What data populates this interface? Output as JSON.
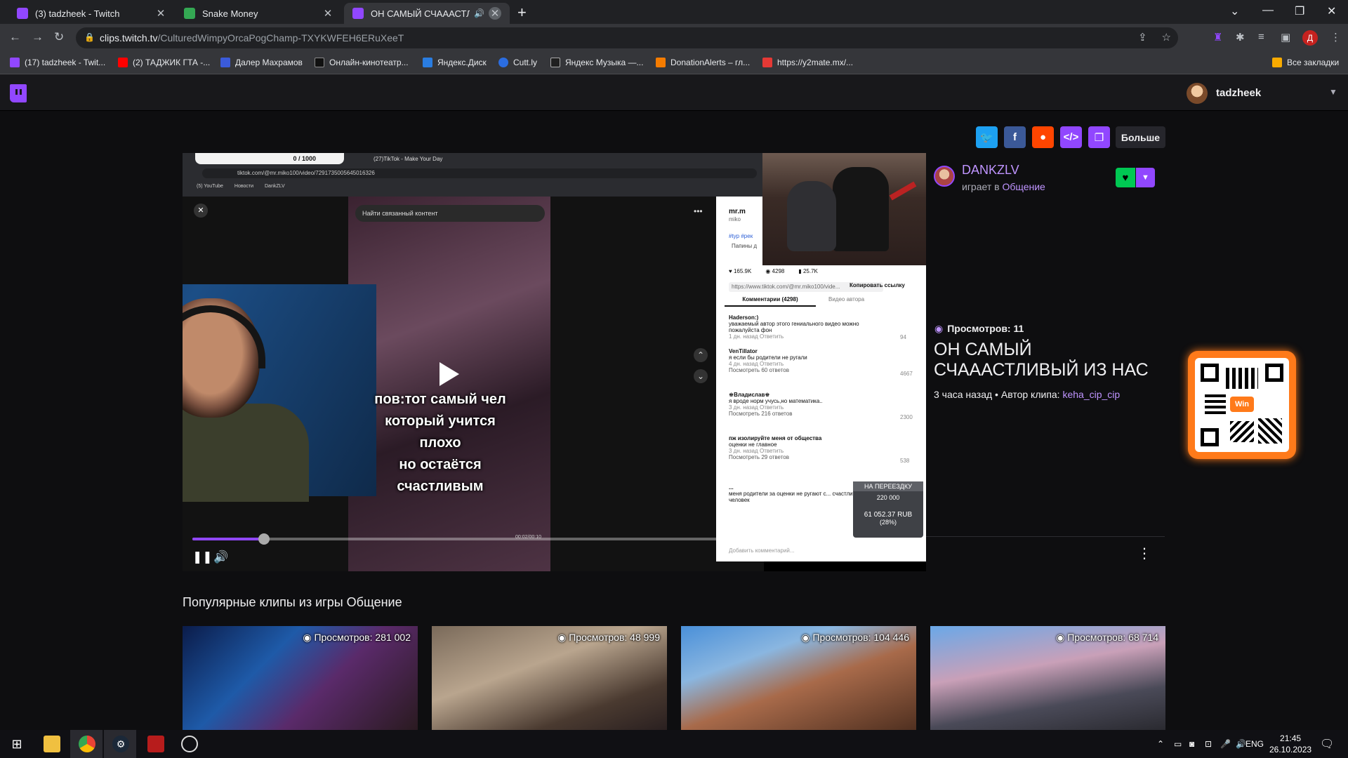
{
  "browser": {
    "tabs": [
      {
        "title": "(3) tadzheek - Twitch"
      },
      {
        "title": "Snake Money"
      },
      {
        "title": "ОН САМЫЙ СЧАААСТЛИ"
      }
    ],
    "url_host": "clips.twitch.tv",
    "url_path": "/CulturedWimpyOrcaPogChamp-TXYKWFEH6ERuXeeT",
    "profile_initial": "Д",
    "bookmarks": [
      {
        "label": "(17) tadzheek - Twit...",
        "color": "#9147ff"
      },
      {
        "label": "(2) ТАДЖИК ГТА -...",
        "color": "#ff0000"
      },
      {
        "label": "Далер Махрамов",
        "color": "#3b5bdb"
      },
      {
        "label": "Онлайн-кинотеатр...",
        "color": "#111111"
      },
      {
        "label": "Яндекс.Диск",
        "color": "#2a7de1"
      },
      {
        "label": "Cutt.ly",
        "color": "#2b6de0"
      },
      {
        "label": "Яндекс Музыка —...",
        "color": "#202020"
      },
      {
        "label": "DonationAlerts – гл...",
        "color": "#f57c00"
      },
      {
        "label": "https://y2mate.mx/...",
        "color": "#e53935"
      }
    ],
    "all_bookmarks": "Все закладки"
  },
  "twitch": {
    "username": "tadzheek",
    "share_more": "Больше",
    "streamer": "DANKZLV",
    "plays_prefix": "играет в",
    "game": "Общение",
    "views": "Просмотров: 11",
    "clip_title": "ОН САМЫЙ СЧАААСТЛИВЫЙ ИЗ НАС",
    "clip_age": "3 часа назад",
    "author_prefix": "Автор клипа:",
    "author": "keha_cip_cip",
    "qr_label": "Win",
    "popular_title": "Популярные клипы из игры Общение",
    "popular": [
      {
        "views": "Просмотров: 281 002"
      },
      {
        "views": "Просмотров: 48 999"
      },
      {
        "views": "Просмотров: 104 446"
      },
      {
        "views": "Просмотров: 68 714"
      }
    ]
  },
  "video": {
    "progress": 0.1,
    "caption_lines": [
      "пов:тот самый чел",
      "который учится плохо",
      "но остаётся",
      "счастливым"
    ],
    "inner_url": "tiktok.com/@mr.miko100/video/7291735005645016326",
    "inner_search": "Найти связанный контент",
    "inner_bookmarks": [
      "(5) YouTube",
      "Новости",
      "DankZLV"
    ],
    "inner_tabs": [
      "(27)TikTok - Make Your Day"
    ],
    "counter": "0 / 1000",
    "time": "00:02/00:10",
    "stats": [
      "165.9K",
      "4298",
      "25.7K"
    ],
    "copy_link": "Копировать ссылку",
    "share_url": "https://www.tiktok.com/@mr.miko100/vide...",
    "comments_tab": "Комментарии (4298)",
    "author_videos_tab": "Видео автора",
    "comments": [
      {
        "user": "Haderson:)",
        "text": "уважаемый автор этого гениального видео можно пожалуйста фон",
        "meta": "1 дн. назад   Ответить",
        "likes": "94"
      },
      {
        "user": "VenTillator",
        "text": "я если бы родители не ругали",
        "meta": "4 дн. назад   Ответить",
        "likes": "4667",
        "replies": "Посмотреть 60 ответов"
      },
      {
        "user": "♚Владислав♚",
        "text": "я вроде норм учусь,но математика..",
        "meta": "3 дн. назад   Ответить",
        "likes": "2300",
        "replies": "Посмотреть 216 ответов"
      },
      {
        "user": "пж изолируйте меня от общества",
        "text": "оценки не главное",
        "meta": "3 дн. назад   Ответить",
        "likes": "538",
        "replies": "Посмотреть 29 ответов"
      },
      {
        "user": "...",
        "text": "меня родители за оценки не ругают с... счастливый человек",
        "meta": "",
        "likes": ""
      }
    ],
    "add_comment": "Добавить комментарий...",
    "donation": {
      "title": "НА ПЕРЕЕЗДКУ",
      "goal": "220 000",
      "amount": "61 052.37 RUB",
      "percent": "(28%)"
    },
    "profile_handle": "mr.m",
    "profile_sub": "miko",
    "tags": "#typ #рек",
    "sound": "Папины д"
  },
  "taskbar": {
    "lang": "ENG",
    "time": "21:45",
    "date": "26.10.2023"
  }
}
